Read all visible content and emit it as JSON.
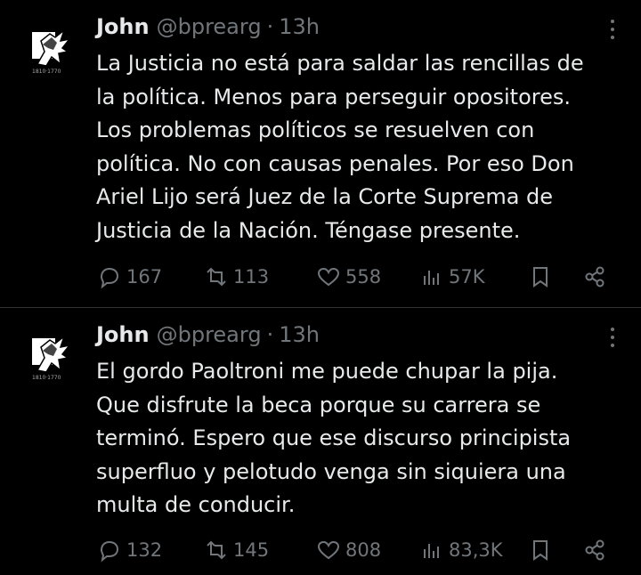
{
  "tweets": [
    {
      "name": "John",
      "handle": "@bprearg",
      "separator": "·",
      "time": "13h",
      "text": "La Justicia no está para saldar las rencillas de\nla política. Menos para perseguir opositores.\nLos problemas políticos se resuelven con\npolítica. No con causas penales. Por eso Don\nAriel Lijo será Juez de la Corte Suprema de\nJusticia de la Nación. Téngase presente.",
      "replies": "167",
      "reposts": "113",
      "likes": "558",
      "views": "57K"
    },
    {
      "name": "John",
      "handle": "@bprearg",
      "separator": "·",
      "time": "13h",
      "text": "El gordo Paoltroni me puede chupar la pija.\nQue disfrute la beca porque su carrera se\nterminó. Espero que ese discurso principista\nsuperfluo y pelotudo venga sin siquiera una\nmulta de conducir.",
      "replies": "132",
      "reposts": "145",
      "likes": "808",
      "views": "83,3K"
    }
  ],
  "icons": {
    "avatar": "eagle-logo-icon",
    "more": "more-options-icon",
    "reply": "reply-icon",
    "repost": "repost-icon",
    "like": "heart-icon",
    "views": "views-icon",
    "bookmark": "bookmark-icon",
    "share": "share-icon"
  },
  "colors": {
    "background": "#000000",
    "text": "#e7e9ea",
    "muted": "#71767b",
    "divider": "#2f3336"
  }
}
